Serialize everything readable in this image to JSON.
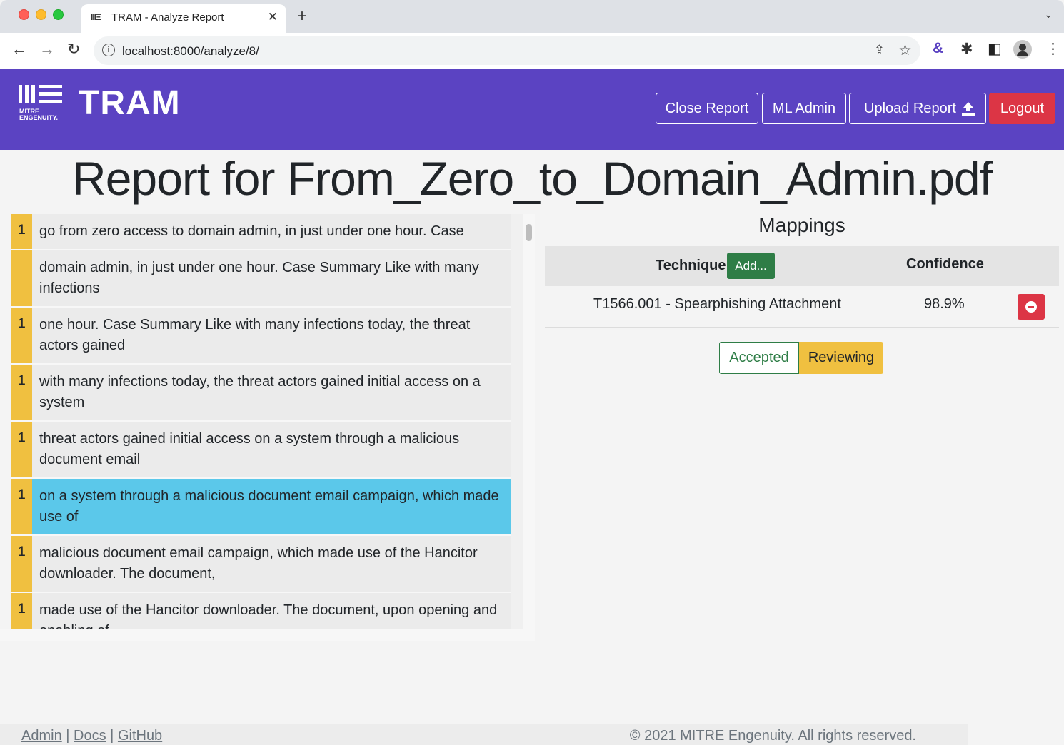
{
  "browser": {
    "tab_icon": "IIIΞ",
    "tab_title": "TRAM - Analyze Report",
    "tab_close": "✕",
    "new_tab": "+",
    "url": "localhost:8000/analyze/8/",
    "back": "←",
    "forward": "→",
    "reload": "↻",
    "info": "i",
    "share": "⇪",
    "star": "☆",
    "ext_ampersand": "&",
    "ext_puzzle": "✱",
    "ext_sidepanel": "◧",
    "ext_menu": "⋮",
    "chevron": "⌄"
  },
  "navbar": {
    "brand": "TRAM",
    "logo_text_1": "MITRE",
    "logo_text_2": "ENGENUITY.",
    "close_report": "Close Report",
    "ml_admin": "ML Admin",
    "upload_report": "Upload Report",
    "logout": "Logout",
    "accent_color": "#5b43c2"
  },
  "page": {
    "title": "Report for From_Zero_to_Domain_Admin.pdf"
  },
  "sentences": [
    {
      "count": "1",
      "text": "go from zero access to domain admin, in just under one hour. Case",
      "selected": false
    },
    {
      "count": "",
      "text": "domain admin, in just under one hour. Case Summary Like with many infections",
      "selected": false
    },
    {
      "count": "1",
      "text": "one hour. Case Summary Like with many infections today, the threat actors gained",
      "selected": false
    },
    {
      "count": "1",
      "text": "with many infections today, the threat actors gained initial access on a system",
      "selected": false
    },
    {
      "count": "1",
      "text": "threat actors gained initial access on a system through a malicious document email",
      "selected": false
    },
    {
      "count": "1",
      "text": "on a system through a malicious document email campaign, which made use of",
      "selected": true
    },
    {
      "count": "1",
      "text": "malicious document email campaign, which made use of the Hancitor downloader. The document,",
      "selected": false
    },
    {
      "count": "1",
      "text": "made use of the Hancitor downloader. The document, upon opening and enabling of",
      "selected": false
    }
  ],
  "mappings": {
    "title": "Mappings",
    "col_technique": "Technique",
    "add_label": "Add...",
    "col_confidence": "Confidence",
    "rows": [
      {
        "technique": "T1566.001 - Spearphishing Attachment",
        "confidence": "98.9%"
      }
    ]
  },
  "status": {
    "accepted": "Accepted",
    "reviewing": "Reviewing"
  },
  "footer": {
    "admin": "Admin",
    "docs": "Docs",
    "github": "GitHub",
    "sep": "|",
    "copyright": "© 2021 MITRE Engenuity. All rights reserved."
  }
}
